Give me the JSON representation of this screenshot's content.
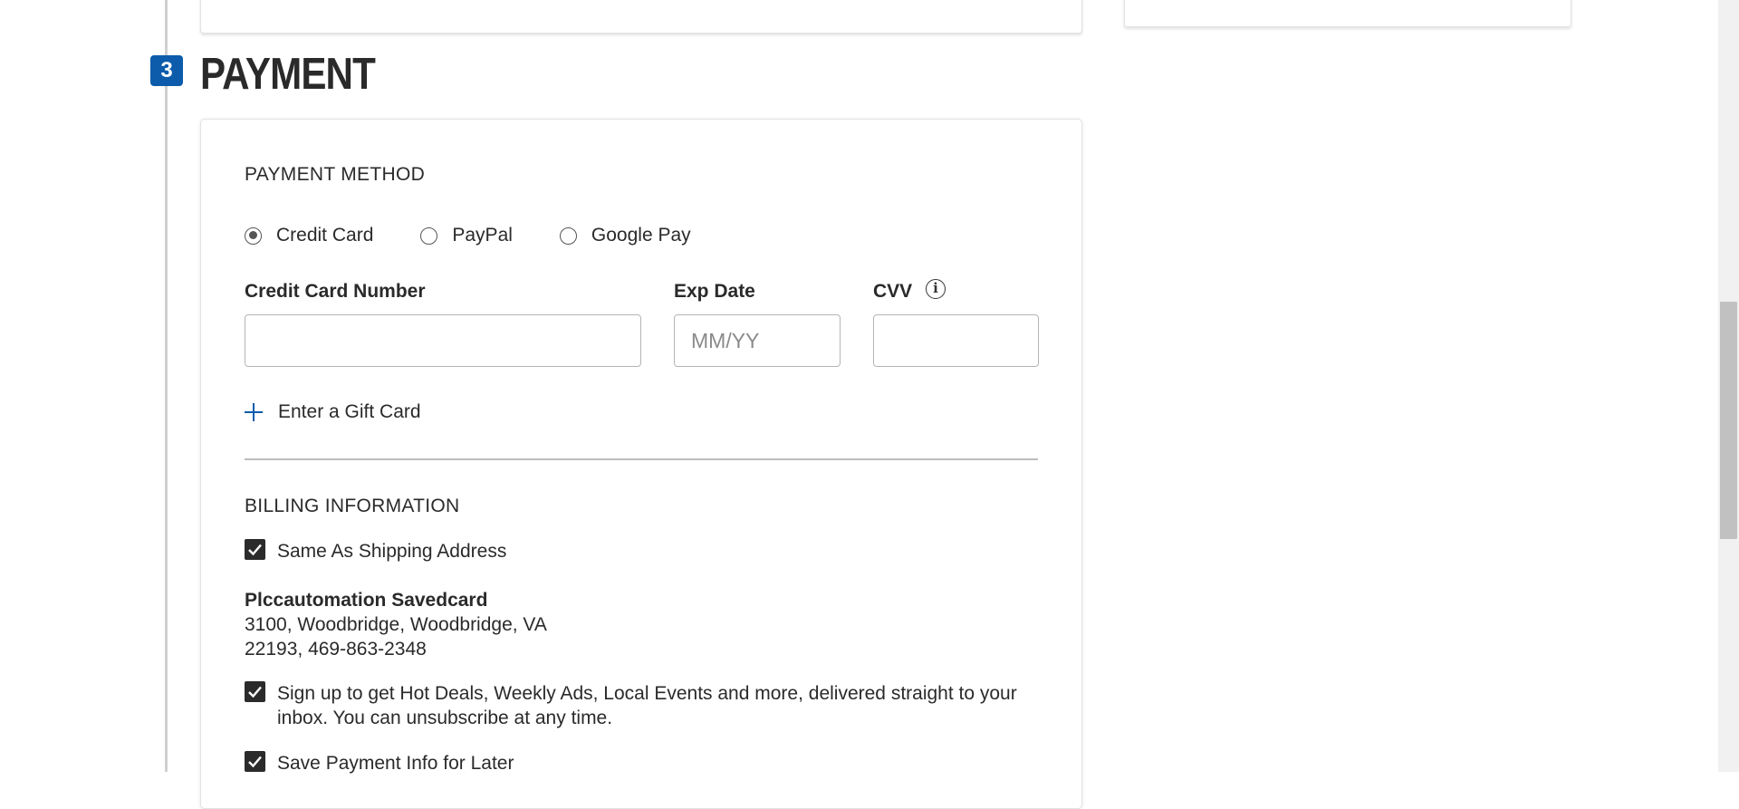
{
  "step": {
    "number": "3",
    "title": "PAYMENT"
  },
  "payment_method": {
    "heading": "PAYMENT METHOD",
    "options": [
      {
        "label": "Credit Card",
        "selected": true
      },
      {
        "label": "PayPal",
        "selected": false
      },
      {
        "label": "Google Pay",
        "selected": false
      }
    ],
    "card_number": {
      "label": "Credit Card Number",
      "value": "",
      "placeholder": ""
    },
    "exp_date": {
      "label": "Exp Date",
      "value": "",
      "placeholder": "MM/YY"
    },
    "cvv": {
      "label": "CVV",
      "value": "",
      "placeholder": "",
      "info_icon": "info-icon"
    },
    "gift_card_link": "Enter a Gift Card"
  },
  "billing": {
    "heading": "BILLING INFORMATION",
    "same_as_shipping": {
      "label": "Same As Shipping Address",
      "checked": true
    },
    "address": {
      "name": "Plccautomation Savedcard",
      "line1": "3100, Woodbridge, Woodbridge, VA",
      "line2": "22193, 469-863-2348"
    },
    "signup": {
      "label": "Sign up to get Hot Deals, Weekly Ads, Local Events and more, delivered straight to your inbox. You can unsubscribe at any time.",
      "checked": true
    },
    "save_payment": {
      "label": "Save Payment Info for Later",
      "checked": true
    }
  },
  "colors": {
    "accent": "#0d5cab",
    "text": "#2a2a2a",
    "checkbox": "#2b2b2b"
  }
}
